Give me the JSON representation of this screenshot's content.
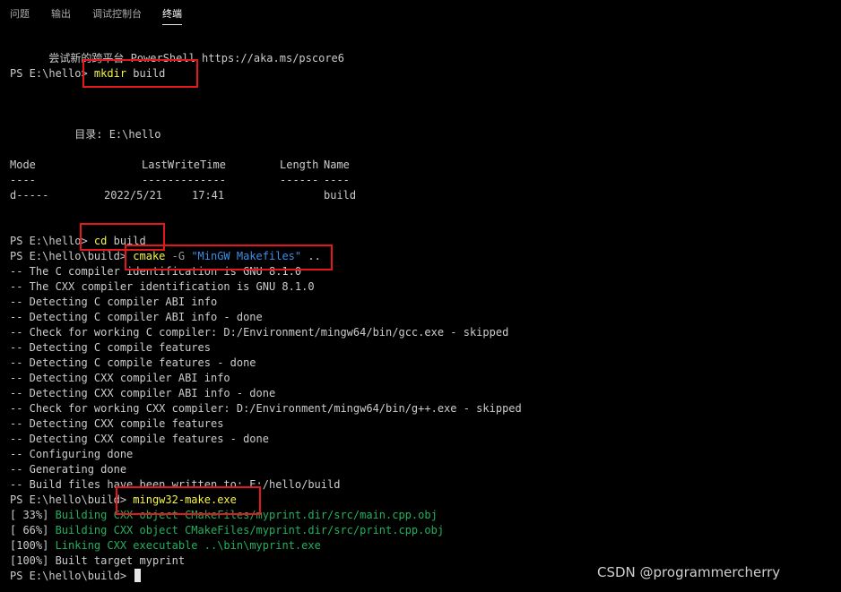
{
  "panel_tabs": [
    {
      "label": "问题"
    },
    {
      "label": "输出"
    },
    {
      "label": "调试控制台"
    },
    {
      "label": "终端"
    }
  ],
  "terminal": {
    "banner": "尝试新的跨平台 PowerShell https://aka.ms/pscore6",
    "cmd_mkdir": {
      "prompt": "PS E:\\hello> ",
      "cmd": "mkdir",
      "arg": " build"
    },
    "dir_header": "    目录: E:\\hello",
    "table_header": [
      {
        "text": "Mode",
        "col": "mode"
      },
      {
        "text": "LastWriteTime",
        "col": "lwt"
      },
      {
        "text": "Length",
        "col": "len"
      },
      {
        "text": "Name",
        "col": "name"
      }
    ],
    "table_sep": [
      {
        "text": "----",
        "col": "mode"
      },
      {
        "text": "-------------",
        "col": "lwt"
      },
      {
        "text": "------",
        "col": "len"
      },
      {
        "text": "----",
        "col": "name"
      }
    ],
    "table_row": [
      {
        "text": "d-----",
        "col": "mode"
      },
      {
        "text": "2022/5/21",
        "col": "date"
      },
      {
        "text": "17:41",
        "col": "time"
      },
      {
        "text": "build",
        "col": "name"
      }
    ],
    "cmd_cd": {
      "prompt": "PS E:\\hello> ",
      "cmd": "cd",
      "arg": " build"
    },
    "cmd_cmake": {
      "prompt": "PS E:\\hello\\build> ",
      "cmd": "cmake",
      "flag": " -G ",
      "str": "\"MinGW Makefiles\"",
      "arg": " .."
    },
    "cmake_output": [
      "-- The C compiler identification is GNU 8.1.0",
      "-- The CXX compiler identification is GNU 8.1.0",
      "-- Detecting C compiler ABI info",
      "-- Detecting C compiler ABI info - done",
      "-- Check for working C compiler: D:/Environment/mingw64/bin/gcc.exe - skipped",
      "-- Detecting C compile features",
      "-- Detecting C compile features - done",
      "-- Detecting CXX compiler ABI info",
      "-- Detecting CXX compiler ABI info - done",
      "-- Check for working CXX compiler: D:/Environment/mingw64/bin/g++.exe - skipped",
      "-- Detecting CXX compile features",
      "-- Detecting CXX compile features - done",
      "-- Configuring done",
      "-- Generating done",
      "-- Build files have been written to: E:/hello/build"
    ],
    "cmd_make": {
      "prompt": "PS E:\\hello\\build> ",
      "cmd": "mingw32-make.exe"
    },
    "make_output": [
      {
        "pct": "[ 33%] ",
        "text": "Building CXX object CMakeFiles/myprint.dir/src/main.cpp.obj",
        "green": true
      },
      {
        "pct": "[ 66%] ",
        "text": "Building CXX object CMakeFiles/myprint.dir/src/print.cpp.obj",
        "green": true
      },
      {
        "pct": "[100%] ",
        "text": "Linking CXX executable ..\\bin\\myprint.exe",
        "green": true
      },
      {
        "pct": "[100%] ",
        "text": "Built target myprint",
        "green": false
      }
    ],
    "final_prompt": "PS E:\\hello\\build> "
  },
  "watermark": "CSDN @programmercherry",
  "colors": {
    "background": "#000000",
    "command": "#f5f543",
    "string": "#3b8eea",
    "success": "#23b05e",
    "highlight_box": "#e4181c"
  }
}
